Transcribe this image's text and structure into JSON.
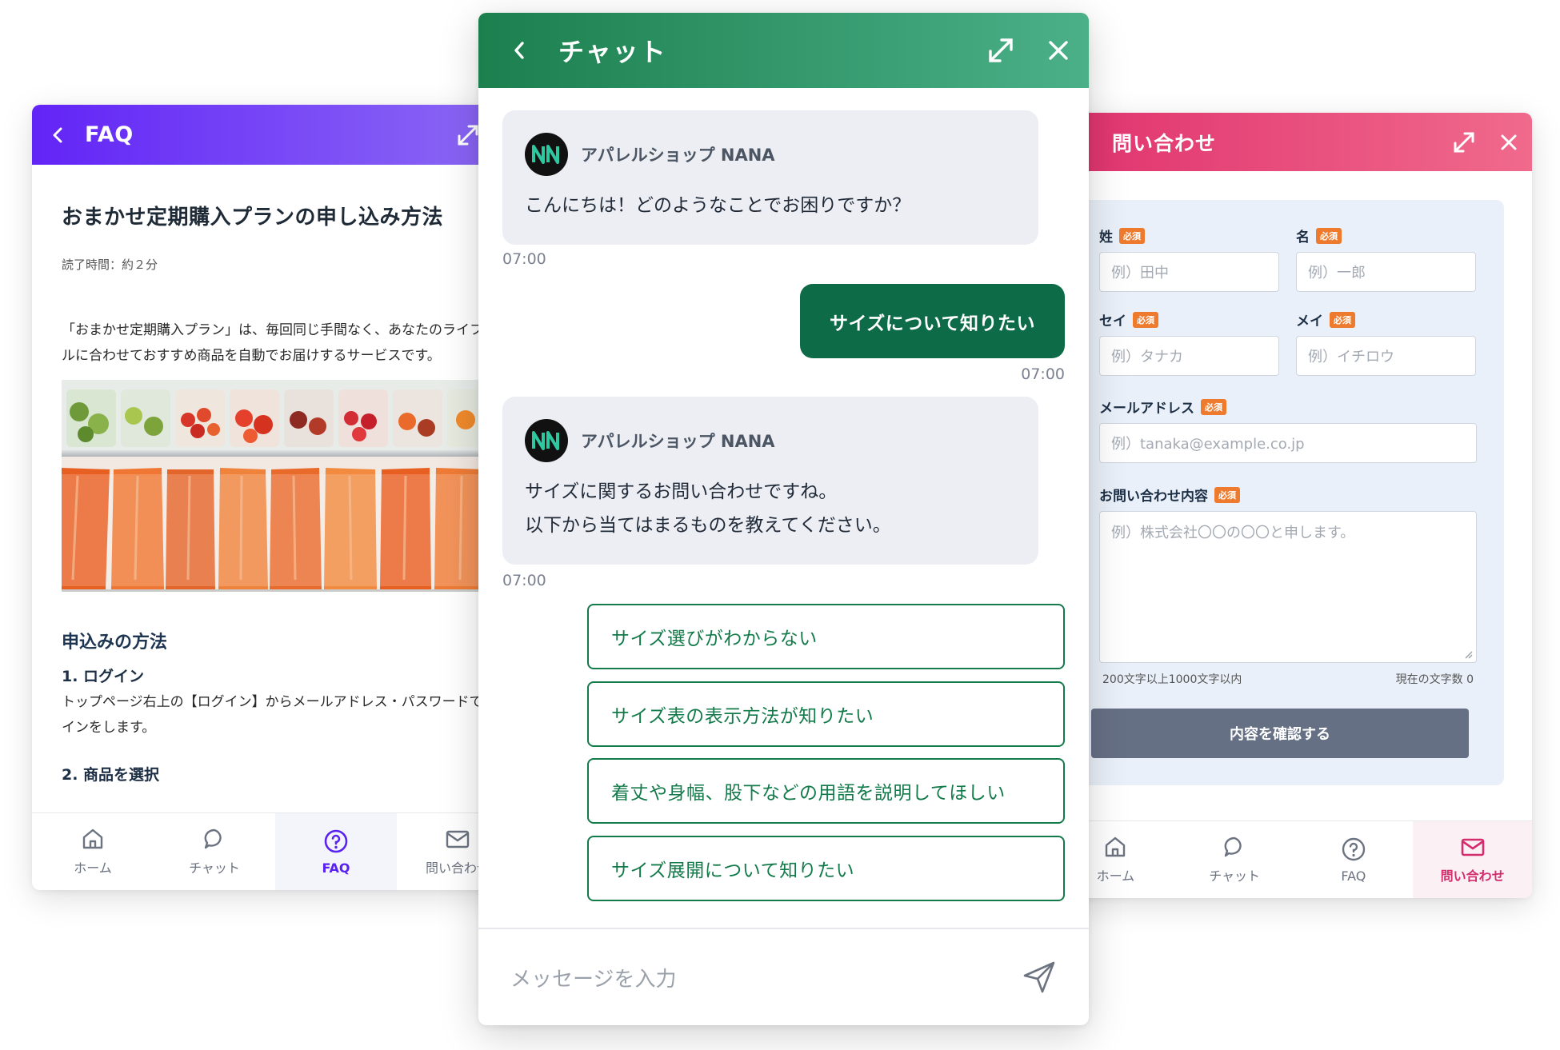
{
  "faq": {
    "header_title": "FAQ",
    "article_title": "おまかせ定期購入プランの申し込み方法",
    "read_time": "読了時間：約２分",
    "intro": "「おまかせ定期購入プラン」は、毎回同じ手間なく、あなたのライフスタイルに合わせておすすめ商品を自動でお届けするサービスです。",
    "section_heading": "申込みの方法",
    "step1_title": "1. ログイン",
    "step1_text": "トップページ右上の【ログイン】からメールアドレス・パスワードでサインインをします。",
    "step2_title": "2. 商品を選択",
    "nav": [
      {
        "label": "ホーム",
        "icon": "home-icon"
      },
      {
        "label": "チャット",
        "icon": "chat-bubble-icon"
      },
      {
        "label": "FAQ",
        "icon": "question-circle-icon"
      },
      {
        "label": "問い合わせ",
        "icon": "mail-icon"
      }
    ],
    "accent": "#5a22f1"
  },
  "chat": {
    "header_title": "チャット",
    "sender": "アパレルショップ NANA",
    "msg1": "こんにちは！どのようなことでお困りですか？",
    "ts1": "07:00",
    "user_msg": "サイズについて知りたい",
    "ts2": "07:00",
    "msg2_line1": "サイズに関するお問い合わせですね。",
    "msg2_line2": "以下から当てはまるものを教えてください。",
    "ts3": "07:00",
    "options": [
      "サイズ選びがわからない",
      "サイズ表の表示方法が知りたい",
      "着丈や身幅、股下などの用語を説明してほしい",
      "サイズ展開について知りたい"
    ],
    "input_placeholder": "メッセージを入力",
    "accent": "#0e6b47"
  },
  "contact": {
    "header_title": "問い合わせ",
    "required_badge": "必須",
    "last_name_label": "姓",
    "last_name_placeholder": "例）田中",
    "first_name_label": "名",
    "first_name_placeholder": "例）一郎",
    "last_kana_label": "セイ",
    "last_kana_placeholder": "例）タナカ",
    "first_kana_label": "メイ",
    "first_kana_placeholder": "例）イチロウ",
    "email_label": "メールアドレス",
    "email_placeholder": "例）tanaka@example.co.jp",
    "message_label": "お問い合わせ内容",
    "message_placeholder": "例）株式会社〇〇の〇〇と申します。",
    "length_hint": "200文字以上1000文字以内",
    "char_count": "現在の文字数 0",
    "confirm_button": "内容を確認する",
    "nav": [
      {
        "label": "ホーム",
        "icon": "home-icon"
      },
      {
        "label": "チャット",
        "icon": "chat-bubble-icon"
      },
      {
        "label": "FAQ",
        "icon": "question-circle-icon"
      },
      {
        "label": "問い合わせ",
        "icon": "mail-icon"
      }
    ],
    "accent": "#d42c6c"
  }
}
